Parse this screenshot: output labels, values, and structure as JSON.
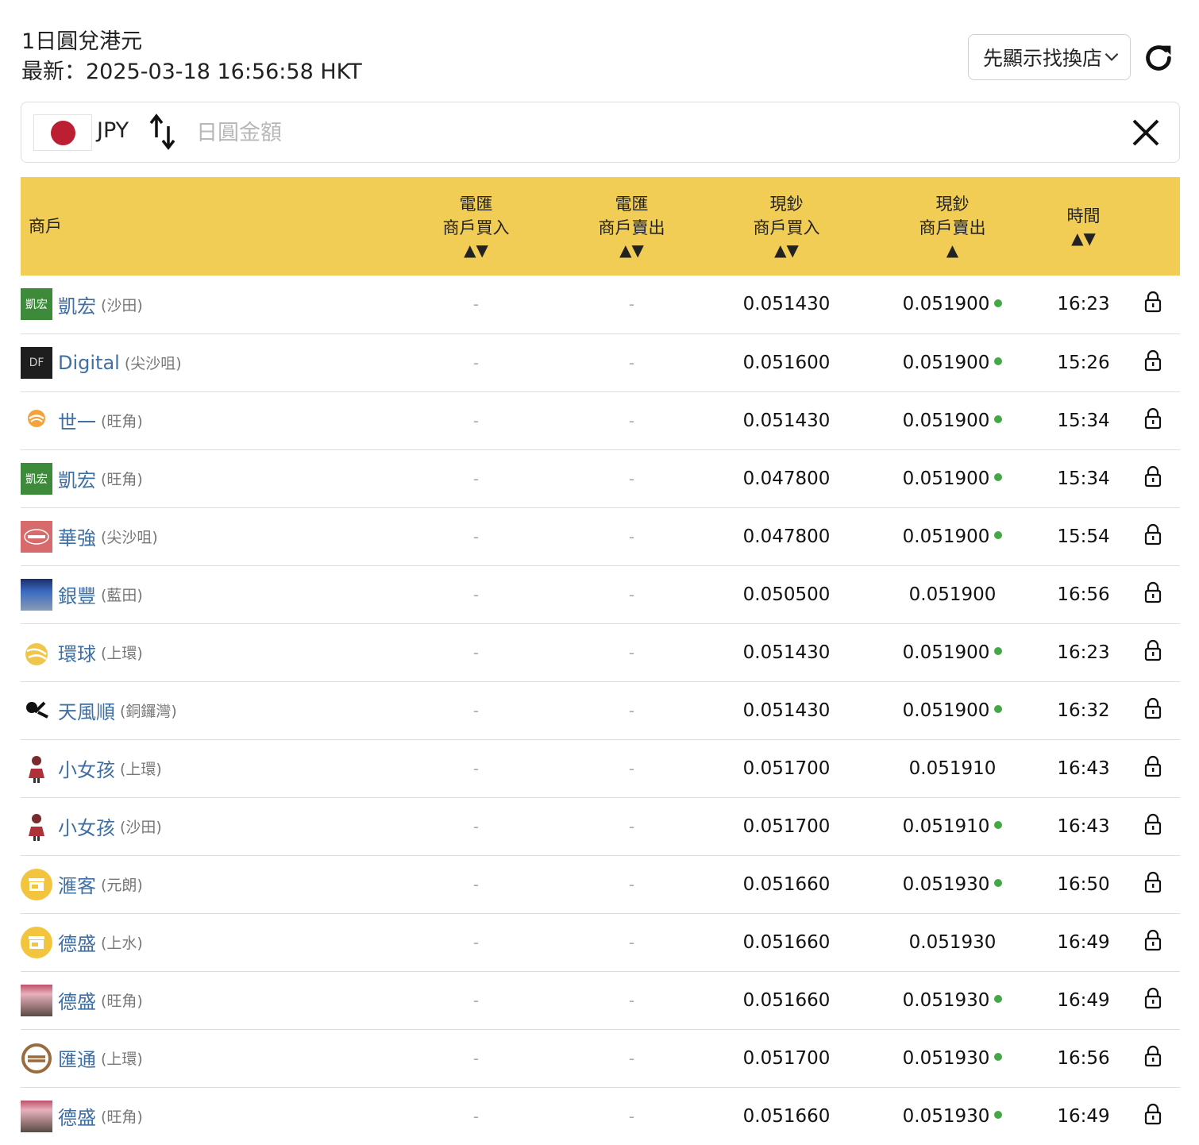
{
  "header": {
    "title": "1日圓兌港元",
    "updated": "最新：2025-03-18 16:56:58 HKT"
  },
  "select": {
    "value": "先顯示找換店"
  },
  "converter": {
    "currency": "JPY",
    "amount_placeholder": "日圓金額",
    "amount_value": ""
  },
  "columns": {
    "merchant": "商戶",
    "tt_buy_l1": "電匯",
    "tt_buy_l2": "商戶買入",
    "tt_buy_sort": "▲▼",
    "tt_sell_l1": "電匯",
    "tt_sell_l2": "商戶賣出",
    "tt_sell_sort": "▲▼",
    "cash_buy_l1": "現鈔",
    "cash_buy_l2": "商戶買入",
    "cash_buy_sort": "▲▼",
    "cash_sell_l1": "現鈔",
    "cash_sell_l2": "商戶賣出",
    "cash_sell_sort": "▲",
    "time_l1": "時間",
    "time_sort": "▲▼"
  },
  "rows": [
    {
      "name": "凱宏",
      "district": "(沙田)",
      "logo": "green",
      "logo_text": "凱宏",
      "tt_buy": "-",
      "tt_sell": "-",
      "cash_buy": "0.051430",
      "cash_sell": "0.051900",
      "dot": true,
      "time": "16:23"
    },
    {
      "name": "Digital",
      "district": "(尖沙咀)",
      "logo": "dark",
      "logo_text": "DF",
      "tt_buy": "-",
      "tt_sell": "-",
      "cash_buy": "0.051600",
      "cash_sell": "0.051900",
      "dot": true,
      "time": "15:26"
    },
    {
      "name": "世一",
      "district": "(旺角)",
      "logo": "orange",
      "logo_text": "",
      "tt_buy": "-",
      "tt_sell": "-",
      "cash_buy": "0.051430",
      "cash_sell": "0.051900",
      "dot": true,
      "time": "15:34"
    },
    {
      "name": "凱宏",
      "district": "(旺角)",
      "logo": "green",
      "logo_text": "凱宏",
      "tt_buy": "-",
      "tt_sell": "-",
      "cash_buy": "0.047800",
      "cash_sell": "0.051900",
      "dot": true,
      "time": "15:34"
    },
    {
      "name": "華強",
      "district": "(尖沙咀)",
      "logo": "red",
      "logo_text": "",
      "tt_buy": "-",
      "tt_sell": "-",
      "cash_buy": "0.047800",
      "cash_sell": "0.051900",
      "dot": true,
      "time": "15:54"
    },
    {
      "name": "銀豐",
      "district": "(藍田)",
      "logo": "photo",
      "logo_text": "",
      "tt_buy": "-",
      "tt_sell": "-",
      "cash_buy": "0.050500",
      "cash_sell": "0.051900",
      "dot": false,
      "time": "16:56"
    },
    {
      "name": "環球",
      "district": "(上環)",
      "logo": "globe",
      "logo_text": "",
      "tt_buy": "-",
      "tt_sell": "-",
      "cash_buy": "0.051430",
      "cash_sell": "0.051900",
      "dot": true,
      "time": "16:23"
    },
    {
      "name": "天風順",
      "district": "(銅鑼灣)",
      "logo": "ink",
      "logo_text": "",
      "tt_buy": "-",
      "tt_sell": "-",
      "cash_buy": "0.051430",
      "cash_sell": "0.051900",
      "dot": true,
      "time": "16:32"
    },
    {
      "name": "小女孩",
      "district": "(上環)",
      "logo": "girl",
      "logo_text": "",
      "tt_buy": "-",
      "tt_sell": "-",
      "cash_buy": "0.051700",
      "cash_sell": "0.051910",
      "dot": false,
      "time": "16:43"
    },
    {
      "name": "小女孩",
      "district": "(沙田)",
      "logo": "girl",
      "logo_text": "",
      "tt_buy": "-",
      "tt_sell": "-",
      "cash_buy": "0.051700",
      "cash_sell": "0.051910",
      "dot": true,
      "time": "16:43"
    },
    {
      "name": "滙客",
      "district": "(元朗)",
      "logo": "store",
      "logo_text": "",
      "tt_buy": "-",
      "tt_sell": "-",
      "cash_buy": "0.051660",
      "cash_sell": "0.051930",
      "dot": true,
      "time": "16:50"
    },
    {
      "name": "德盛",
      "district": "(上水)",
      "logo": "store",
      "logo_text": "",
      "tt_buy": "-",
      "tt_sell": "-",
      "cash_buy": "0.051660",
      "cash_sell": "0.051930",
      "dot": false,
      "time": "16:49"
    },
    {
      "name": "德盛",
      "district": "(旺角)",
      "logo": "photo2",
      "logo_text": "",
      "tt_buy": "-",
      "tt_sell": "-",
      "cash_buy": "0.051660",
      "cash_sell": "0.051930",
      "dot": true,
      "time": "16:49"
    },
    {
      "name": "匯通",
      "district": "(上環)",
      "logo": "brown",
      "logo_text": "",
      "tt_buy": "-",
      "tt_sell": "-",
      "cash_buy": "0.051700",
      "cash_sell": "0.051930",
      "dot": true,
      "time": "16:56"
    },
    {
      "name": "德盛",
      "district": "(旺角)",
      "logo": "photo2",
      "logo_text": "",
      "tt_buy": "-",
      "tt_sell": "-",
      "cash_buy": "0.051660",
      "cash_sell": "0.051930",
      "dot": true,
      "time": "16:49"
    }
  ],
  "colors": {
    "header_bg": "#f1cd56",
    "link": "#3f6fa3",
    "live_dot": "#43a845",
    "flag_red": "#bc1f32"
  }
}
